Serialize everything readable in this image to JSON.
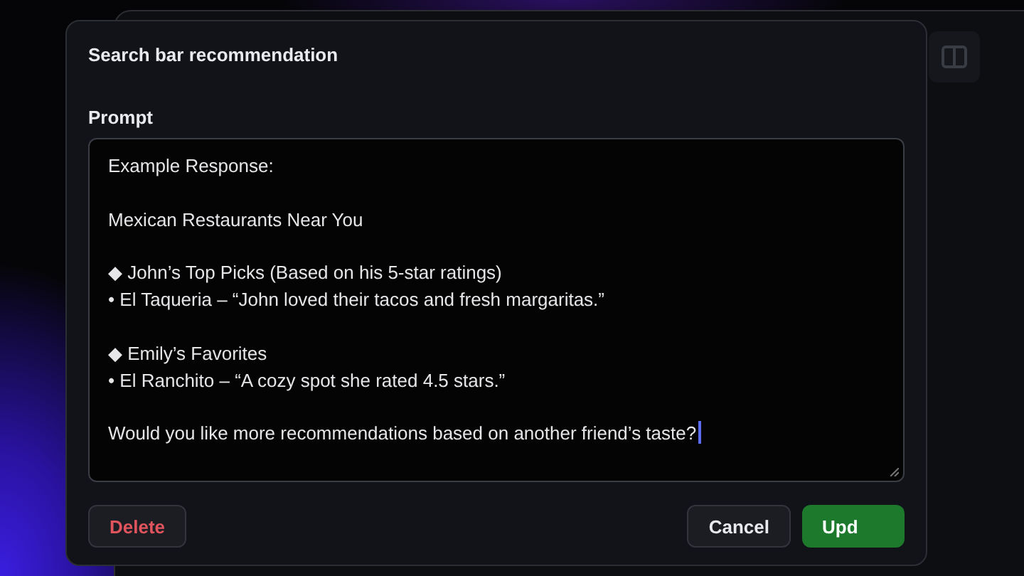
{
  "dialog": {
    "title": "Search bar recommendation",
    "prompt": {
      "label": "Prompt",
      "paragraphs": [
        [
          {
            "text": "Example Response:"
          }
        ],
        [
          {
            "text": "Mexican Restaurants Near You"
          }
        ],
        [
          {
            "marker": "◆",
            "text": "John’s Top Picks (Based on his 5-star ratings)"
          },
          {
            "marker": "•",
            "text": "El Taqueria – “John loved their tacos and fresh margaritas.”"
          }
        ],
        [
          {
            "marker": "◆",
            "text": "Emily’s Favorites"
          },
          {
            "marker": "•",
            "text": "El Ranchito – “A cozy spot she rated 4.5 stars.”"
          }
        ],
        [
          {
            "text": "Would you like more recommendations based on another friend’s taste?"
          }
        ]
      ]
    },
    "buttons": [
      {
        "label": "Delete",
        "kind": "danger"
      },
      {
        "label": "Cancel",
        "kind": "secondary"
      },
      {
        "label": "Upd",
        "kind": "primary"
      }
    ]
  }
}
